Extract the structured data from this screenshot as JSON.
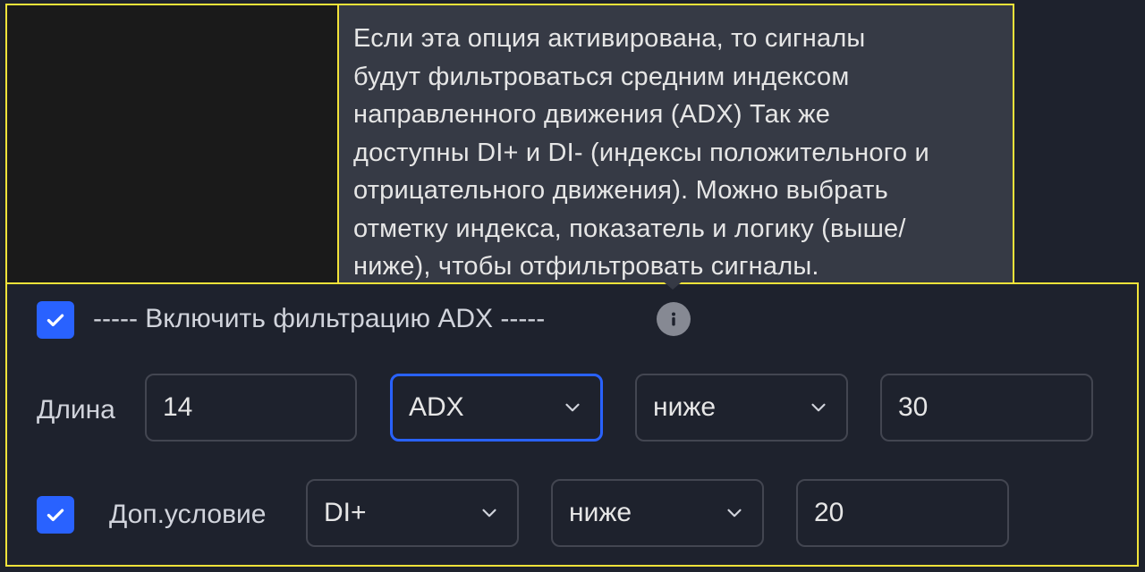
{
  "tooltip": {
    "lines": [
      "Если эта опция активирована, то сигналы",
      "будут фильтроваться средним индексом",
      "направленного движения (ADX) Так же",
      "доступны DI+ и DI- (индексы положительного и",
      "отрицательного движения). Можно выбрать",
      "отметку индекса, показатель и логику (выше/",
      "ниже), чтобы отфильтровать сигналы."
    ]
  },
  "filter": {
    "enabled": true,
    "title": "----- Включить фильтрацию ADX -----",
    "info_icon": "info-icon"
  },
  "row1": {
    "label": "Длина",
    "length_value": "14",
    "indicator_select": "ADX",
    "logic_select": "ниже",
    "threshold_value": "30"
  },
  "row2": {
    "enabled": true,
    "label": "Доп.условие",
    "indicator_select": "DI+",
    "logic_select": "ниже",
    "threshold_value": "20"
  },
  "colors": {
    "accent": "#2962ff",
    "highlight_border": "#f2e33a",
    "tooltip_bg": "#363a45",
    "panel_bg": "#1e222d"
  }
}
